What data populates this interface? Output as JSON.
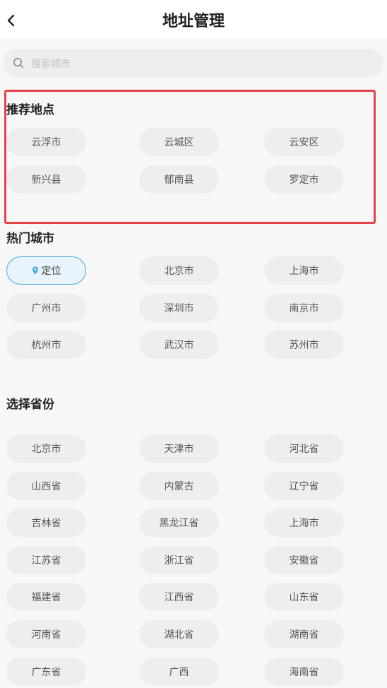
{
  "header": {
    "title": "地址管理",
    "back_icon": "chevron-left-icon"
  },
  "search": {
    "placeholder": "搜索城市",
    "icon": "search-icon"
  },
  "recommended": {
    "title": "推荐地点",
    "items": [
      "云浮市",
      "云城区",
      "云安区",
      "新兴县",
      "郁南县",
      "罗定市"
    ]
  },
  "hot_cities": {
    "title": "热门城市",
    "locate": {
      "label": "定位",
      "icon": "location-pin-icon"
    },
    "items": [
      "北京市",
      "上海市",
      "广州市",
      "深圳市",
      "南京市",
      "杭州市",
      "武汉市",
      "苏州市"
    ]
  },
  "provinces": {
    "title": "选择省份",
    "items": [
      "北京市",
      "天津市",
      "河北省",
      "山西省",
      "内蒙古",
      "辽宁省",
      "吉林省",
      "黑龙江省",
      "上海市",
      "江苏省",
      "浙江省",
      "安徽省",
      "福建省",
      "江西省",
      "山东省",
      "河南省",
      "湖北省",
      "湖南省",
      "广东省",
      "广西",
      "海南省"
    ]
  },
  "colors": {
    "highlight_border": "#e5424a",
    "active_border": "#4aa9df",
    "chip_bg": "#eeeeee"
  }
}
